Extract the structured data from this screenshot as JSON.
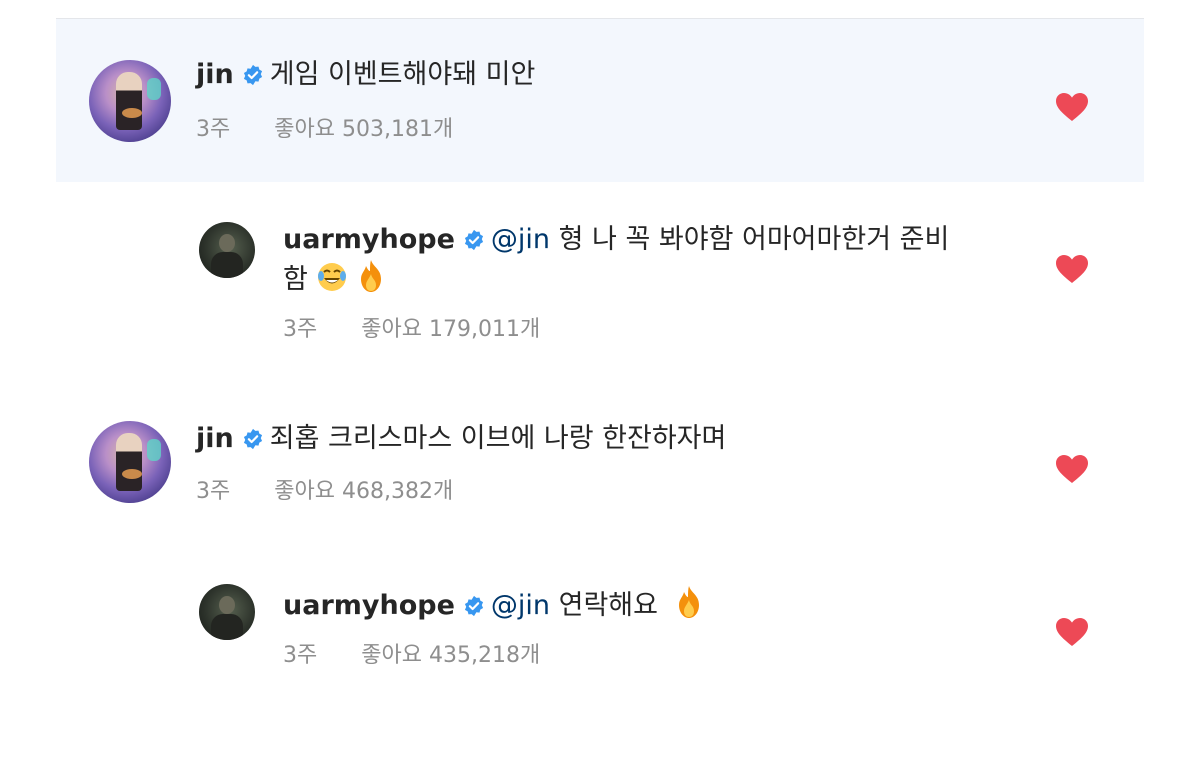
{
  "colors": {
    "heart": "#ed4956",
    "verified_badge": "#3897f0",
    "highlight_background": "#f3f7fd",
    "mention": "#00376b",
    "meta_text": "#8e8e8e"
  },
  "comments": [
    {
      "username": "jin",
      "verified": true,
      "text_line1": "게임 이벤트해야돼 미안",
      "time": "3주",
      "likes": "좋아요 503,181개",
      "liked": true,
      "highlighted": true
    },
    {
      "username": "uarmyhope",
      "verified": true,
      "mention": "@jin",
      "text_line1": "형 나 꼭 봐야함 어마어마한거 준비",
      "text_line2": "함",
      "emojis": [
        "laughing-tears-emoji",
        "fire-emoji"
      ],
      "time": "3주",
      "likes": "좋아요 179,011개",
      "liked": true
    },
    {
      "username": "jin",
      "verified": true,
      "text_line1": "죄홉 크리스마스 이브에 나랑 한잔하자며",
      "time": "3주",
      "likes": "좋아요 468,382개",
      "liked": true
    },
    {
      "username": "uarmyhope",
      "verified": true,
      "mention": "@jin",
      "text_line1": "연락해요",
      "emojis": [
        "fire-emoji"
      ],
      "time": "3주",
      "likes": "좋아요 435,218개",
      "liked": true
    }
  ]
}
